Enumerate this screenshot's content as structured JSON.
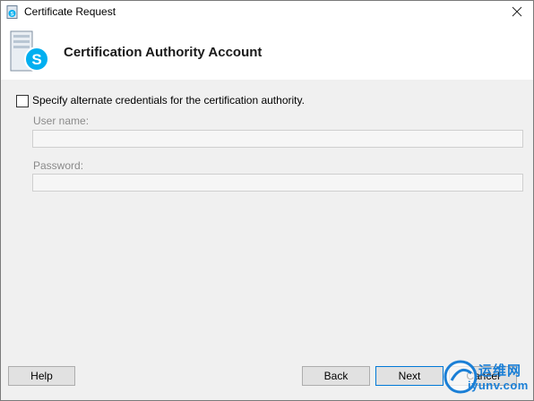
{
  "window": {
    "title": "Certificate Request",
    "close_glyph": "✕",
    "title_icon": "skype-app-icon"
  },
  "header": {
    "title": "Certification Authority Account",
    "icon": "server-skype-icon"
  },
  "form": {
    "checkbox_label": "Specify alternate credentials for the certification authority.",
    "checkbox_checked": false,
    "username_label": "User name:",
    "username_value": "",
    "password_label": "Password:",
    "password_value": ""
  },
  "buttons": {
    "help": "Help",
    "back": "Back",
    "next": "Next",
    "cancel": "Cancel"
  },
  "watermark": {
    "line1": "运维网",
    "line2": "iyunv.com"
  },
  "colors": {
    "accent": "#0078d7",
    "skype_blue": "#00aff0",
    "watermark_blue": "#1a7fd6"
  }
}
